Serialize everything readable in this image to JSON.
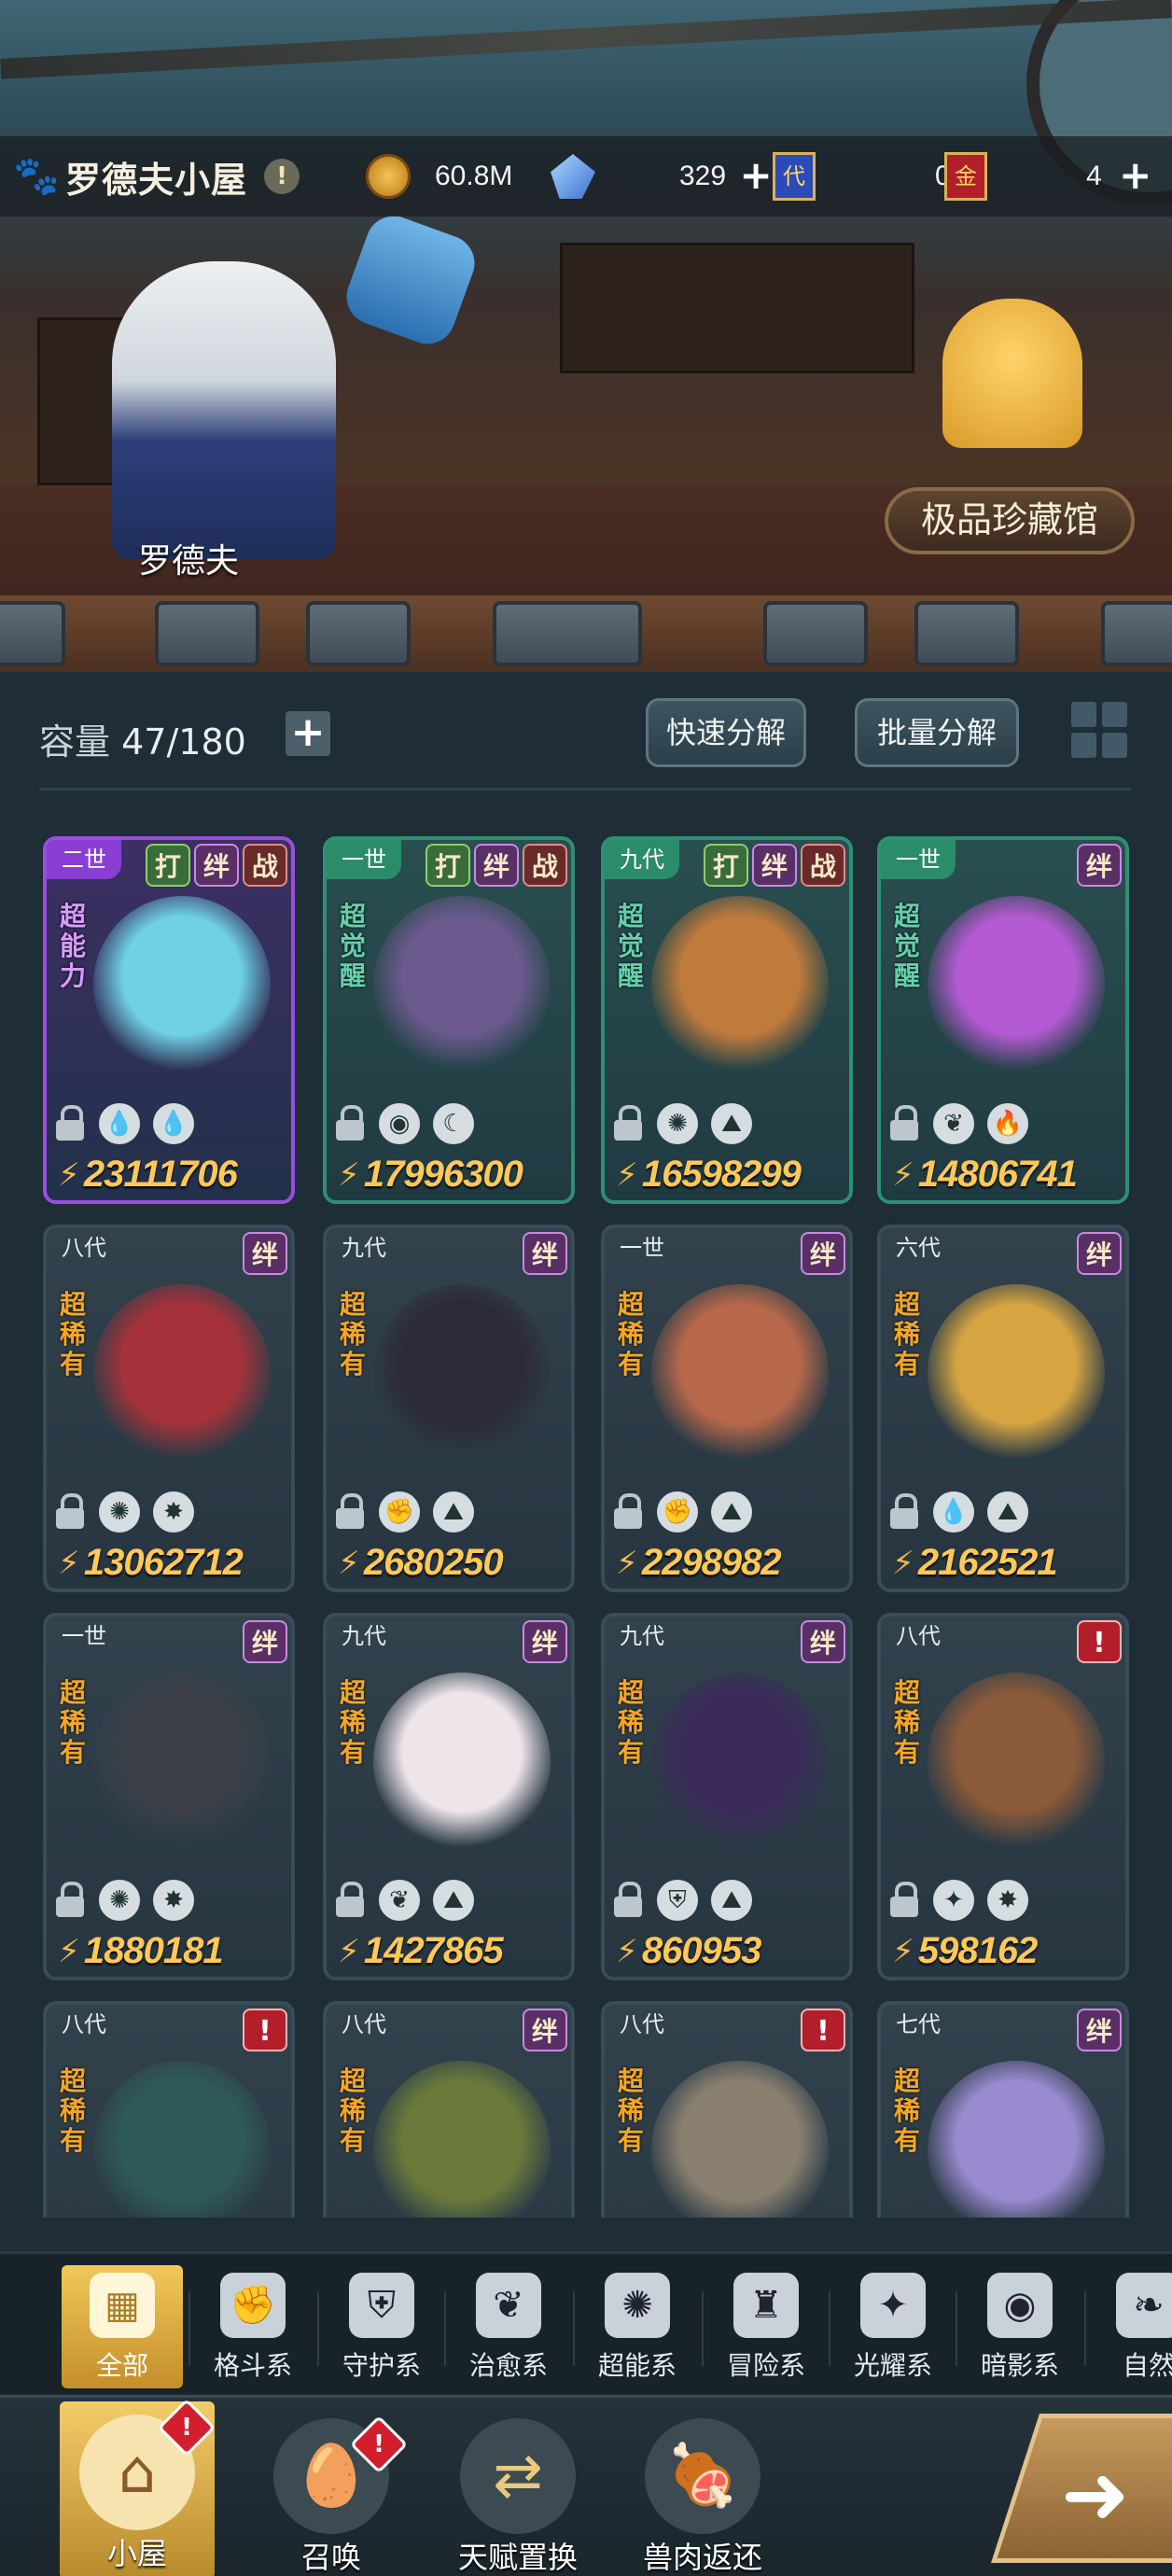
{
  "header": {
    "house_title": "罗德夫小屋",
    "info_icon": "!",
    "resources": [
      {
        "icon": "gold-coin-icon",
        "value": "60.8M",
        "has_plus": false
      },
      {
        "icon": "crystal-icon",
        "value": "329",
        "has_plus": true
      },
      {
        "icon": "blue-ticket-icon",
        "label": "代",
        "value": "0",
        "has_plus": false
      },
      {
        "icon": "red-ticket-icon",
        "label": "金",
        "value": "4",
        "has_plus": true
      }
    ]
  },
  "scene": {
    "npc_name": "罗德夫",
    "museum_button": "极品珍藏馆"
  },
  "storage": {
    "capacity_label": "容量",
    "capacity_value": "47/180",
    "plus": "+",
    "quick_decompose": "快速分解",
    "batch_decompose": "批量分解"
  },
  "cards": [
    {
      "gen": "二世",
      "rarity": "超能力",
      "tags": [
        "打",
        "绊",
        "战"
      ],
      "elements": [
        "💧",
        "💧"
      ],
      "power": "23111706",
      "style": "purple",
      "color": "#6fd0e6"
    },
    {
      "gen": "一世",
      "rarity": "超觉醒",
      "tags": [
        "打",
        "绊",
        "战"
      ],
      "elements": [
        "◉",
        "☾"
      ],
      "power": "17996300",
      "style": "green",
      "color": "#6b5a8e"
    },
    {
      "gen": "九代",
      "rarity": "超觉醒",
      "tags": [
        "打",
        "绊",
        "战"
      ],
      "elements": [
        "✺",
        "⛰"
      ],
      "power": "16598299",
      "style": "green",
      "color": "#c07a3c"
    },
    {
      "gen": "一世",
      "rarity": "超觉醒",
      "tags": [
        "绊"
      ],
      "elements": [
        "❦",
        "🔥"
      ],
      "power": "14806741",
      "style": "green",
      "color": "#b45ad2"
    },
    {
      "gen": "八代",
      "rarity": "超稀有",
      "tags": [
        "绊"
      ],
      "elements": [
        "✺",
        "✸"
      ],
      "power": "13062712",
      "style": "normal",
      "color": "#a5323a"
    },
    {
      "gen": "九代",
      "rarity": "超稀有",
      "tags": [
        "绊"
      ],
      "elements": [
        "✊",
        "⛰"
      ],
      "power": "2680250",
      "style": "normal",
      "color": "#2c2a36"
    },
    {
      "gen": "一世",
      "rarity": "超稀有",
      "tags": [
        "绊"
      ],
      "elements": [
        "✊",
        "⛰"
      ],
      "power": "2298982",
      "style": "normal",
      "color": "#b8684a"
    },
    {
      "gen": "六代",
      "rarity": "超稀有",
      "tags": [
        "绊"
      ],
      "elements": [
        "💧",
        "⛰"
      ],
      "power": "2162521",
      "style": "normal",
      "color": "#d6a542"
    },
    {
      "gen": "一世",
      "rarity": "超稀有",
      "tags": [
        "绊"
      ],
      "elements": [
        "✺",
        "✸"
      ],
      "power": "1880181",
      "style": "normal",
      "color": "#3a3f48"
    },
    {
      "gen": "九代",
      "rarity": "超稀有",
      "tags": [
        "绊"
      ],
      "elements": [
        "❦",
        "⛰"
      ],
      "power": "1427865",
      "style": "normal",
      "color": "#eee4ea"
    },
    {
      "gen": "九代",
      "rarity": "超稀有",
      "tags": [
        "绊"
      ],
      "elements": [
        "⛨",
        "⛰"
      ],
      "power": "860953",
      "style": "normal",
      "color": "#3a2a5a"
    },
    {
      "gen": "八代",
      "rarity": "超稀有",
      "tags": [
        "!"
      ],
      "elements": [
        "✦",
        "✸"
      ],
      "power": "598162",
      "style": "normal",
      "color": "#8a5a3a"
    },
    {
      "gen": "八代",
      "rarity": "超稀有",
      "tags": [
        "!"
      ],
      "elements": [],
      "power": "",
      "style": "normal",
      "color": "#2f5a5a"
    },
    {
      "gen": "八代",
      "rarity": "超稀有",
      "tags": [
        "绊"
      ],
      "elements": [],
      "power": "",
      "style": "normal",
      "color": "#6a7a3a"
    },
    {
      "gen": "八代",
      "rarity": "超稀有",
      "tags": [
        "!"
      ],
      "elements": [],
      "power": "",
      "style": "normal",
      "color": "#8a8070"
    },
    {
      "gen": "七代",
      "rarity": "超稀有",
      "tags": [
        "绊"
      ],
      "elements": [],
      "power": "",
      "style": "normal",
      "color": "#9a8ad0"
    }
  ],
  "filters": [
    {
      "label": "全部",
      "icon": "▦",
      "active": true
    },
    {
      "label": "格斗系",
      "icon": "✊"
    },
    {
      "label": "守护系",
      "icon": "⛨"
    },
    {
      "label": "治愈系",
      "icon": "❦"
    },
    {
      "label": "超能系",
      "icon": "✺"
    },
    {
      "label": "冒险系",
      "icon": "♜"
    },
    {
      "label": "光耀系",
      "icon": "✦"
    },
    {
      "label": "暗影系",
      "icon": "◉"
    },
    {
      "label": "自然",
      "icon": "❧"
    }
  ],
  "nav": [
    {
      "label": "小屋",
      "icon": "⌂",
      "active": true,
      "badge": "!"
    },
    {
      "label": "召唤",
      "icon": "🥚",
      "badge": "!"
    },
    {
      "label": "天赋置换",
      "icon": "⇄"
    },
    {
      "label": "兽肉返还",
      "icon": "🍖"
    }
  ],
  "next_arrow": "➜"
}
